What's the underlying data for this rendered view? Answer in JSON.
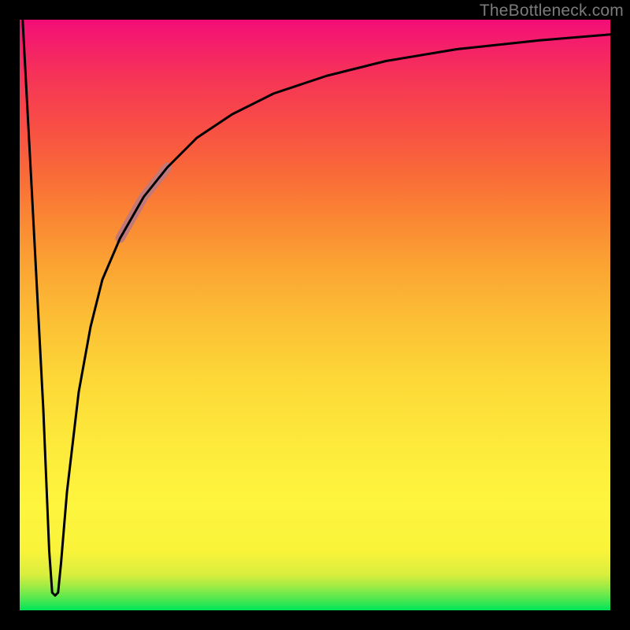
{
  "attribution": "TheBottleneck.com",
  "chart_data": {
    "type": "line",
    "title": "",
    "xlabel": "",
    "ylabel": "",
    "xlim": [
      0,
      100
    ],
    "ylim": [
      0,
      100
    ],
    "grid": false,
    "series": [
      {
        "name": "bottleneck-curve",
        "x": [
          0.5,
          2,
          4,
          5,
          5.5,
          6,
          6.5,
          7,
          8,
          10,
          12,
          14,
          17,
          21,
          25,
          30,
          36,
          43,
          52,
          62,
          74,
          88,
          100
        ],
        "values": [
          100,
          72,
          34,
          10,
          3,
          2.5,
          3,
          8,
          20,
          37,
          48,
          56,
          63,
          70,
          75,
          80,
          84,
          87.5,
          90.5,
          93,
          95,
          96.5,
          97.5
        ]
      }
    ],
    "annotations": [
      {
        "name": "highlight-segment",
        "x_range": [
          17,
          25
        ],
        "color": "#c07878",
        "width": 12
      }
    ]
  }
}
